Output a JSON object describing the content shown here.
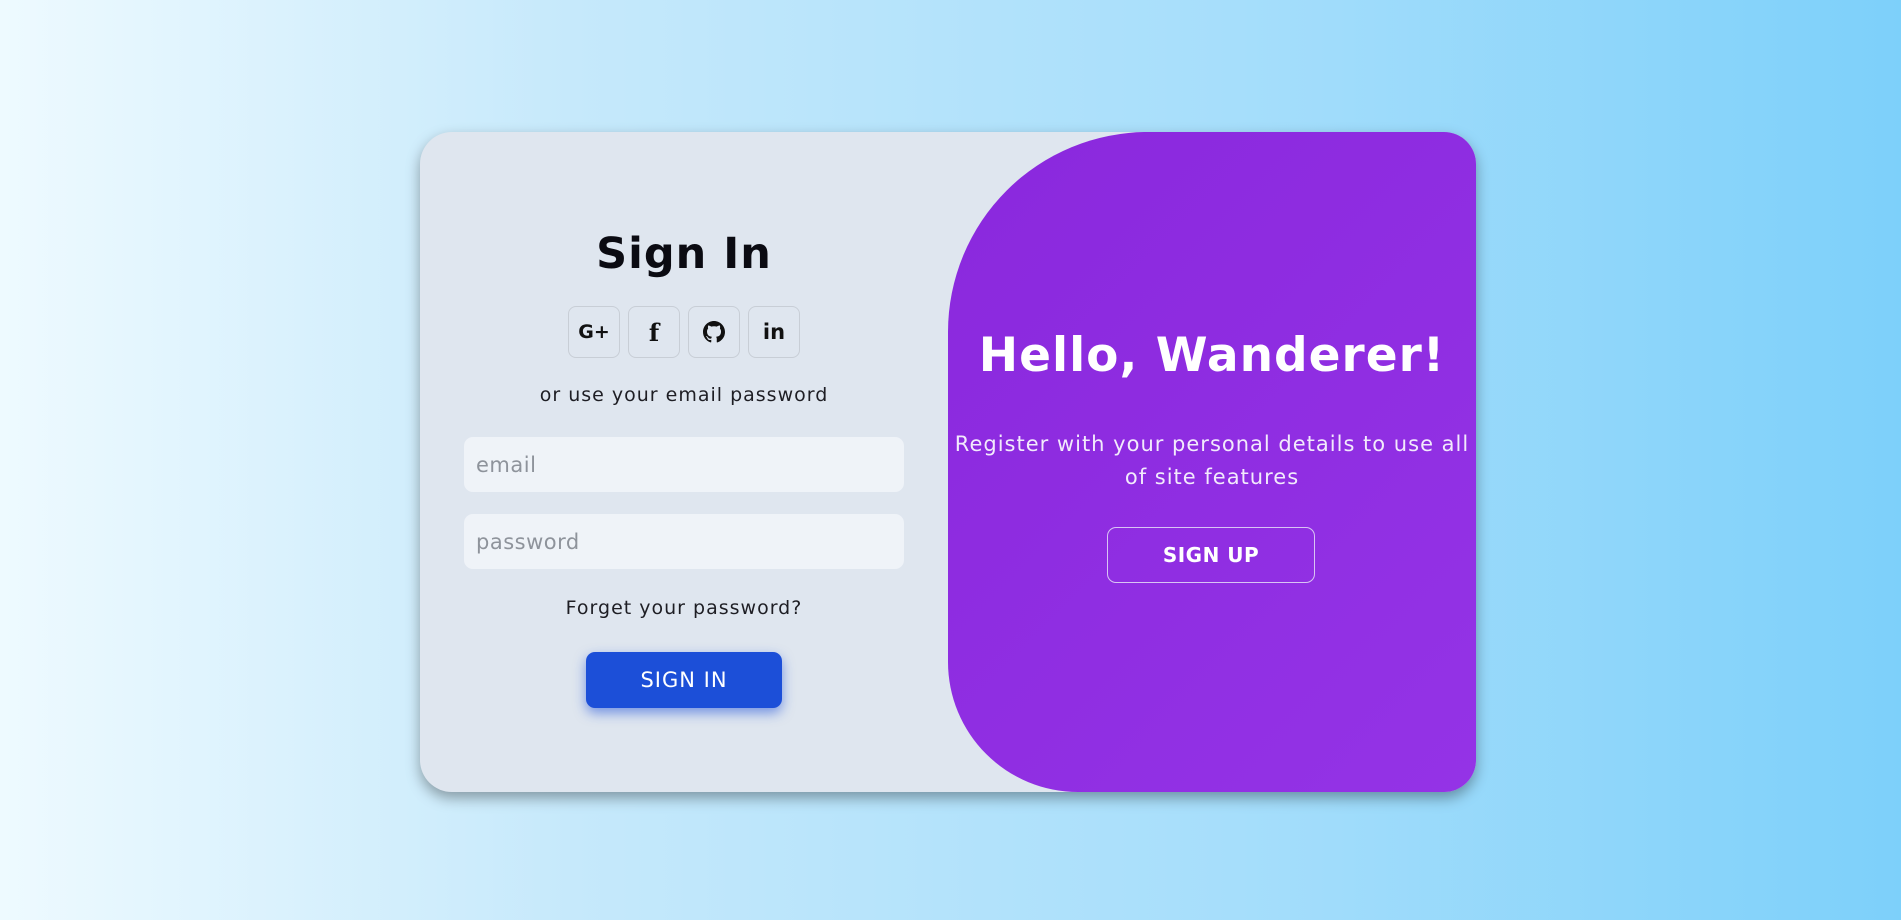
{
  "signin": {
    "title": "Sign In",
    "social": [
      {
        "label": "G+",
        "icon": "google-plus-icon"
      },
      {
        "label": "f",
        "icon": "facebook-icon"
      },
      {
        "label": "",
        "icon": "github-icon"
      },
      {
        "label": "in",
        "icon": "linkedin-icon"
      }
    ],
    "or_text": "or use your email password",
    "email_placeholder": "email",
    "password_placeholder": "password",
    "forgot_text": "Forget your password?",
    "button_label": "SIGN IN"
  },
  "toggle": {
    "title": "Hello, Wanderer!",
    "text": "Register with your personal details to use all of site features",
    "button_label": "SIGN UP"
  },
  "colors": {
    "primary": "#1c4fd8",
    "panel": "#8a28dd",
    "card": "#dfe6ef"
  }
}
